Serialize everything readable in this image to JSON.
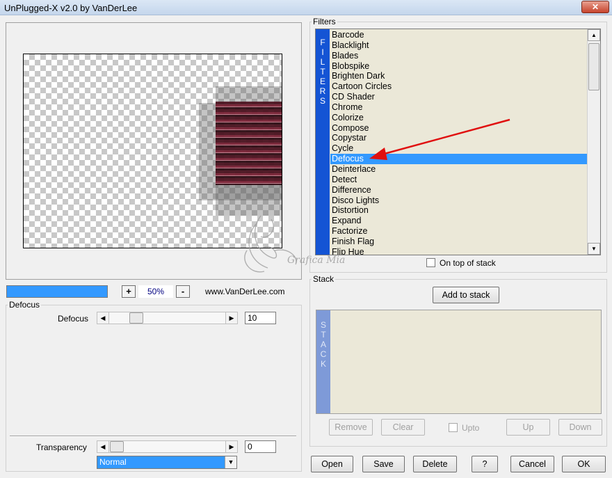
{
  "window": {
    "title": "UnPlugged-X v2.0 by VanDerLee",
    "close_glyph": "✕"
  },
  "toolbar": {
    "zoom_plus": "+",
    "zoom_value": "50%",
    "zoom_minus": "-",
    "website": "www.VanDerLee.com"
  },
  "preview": {
    "watermark_text": "Grafica Mia"
  },
  "defocus": {
    "group_label": "Defocus",
    "param_label": "Defocus",
    "value": "10",
    "transparency_label": "Transparency",
    "transparency_value": "0",
    "blend_mode": "Normal"
  },
  "filters": {
    "group_label": "Filters",
    "side_letters": [
      "F",
      "I",
      "L",
      "T",
      "E",
      "R",
      "S"
    ],
    "selected": "Defocus",
    "items": [
      "Barcode",
      "Blacklight",
      "Blades",
      "Blobspike",
      "Brighten Dark",
      "Cartoon Circles",
      "CD Shader",
      "Chrome",
      "Colorize",
      "Compose",
      "Copystar",
      "Cycle",
      "Defocus",
      "Deinterlace",
      "Detect",
      "Difference",
      "Disco Lights",
      "Distortion",
      "Expand",
      "Factorize",
      "Finish Flag",
      "Flip Hue"
    ],
    "on_top_label": "On top of stack"
  },
  "stack": {
    "group_label": "Stack",
    "add_button": "Add to stack",
    "side_letters": [
      "S",
      "T",
      "A",
      "C",
      "K"
    ],
    "remove_button": "Remove",
    "clear_button": "Clear",
    "upto_label": "Upto",
    "up_button": "Up",
    "down_button": "Down"
  },
  "footer": {
    "open": "Open",
    "save": "Save",
    "delete": "Delete",
    "help": "?",
    "cancel": "Cancel",
    "ok": "OK"
  },
  "glyphs": {
    "arrow_left": "◀",
    "arrow_right": "▶",
    "arrow_up": "▲",
    "arrow_down": "▼"
  },
  "icons": {
    "annotation": "red-arrow-icon",
    "watermark": "flourish-watermark-icon"
  },
  "colors": {
    "selection": "#3399ff",
    "filter_bar": "#1454d4",
    "stack_bar": "#7e9ad8",
    "list_bg": "#ebe8d8",
    "annotation_arrow": "#e01010"
  }
}
